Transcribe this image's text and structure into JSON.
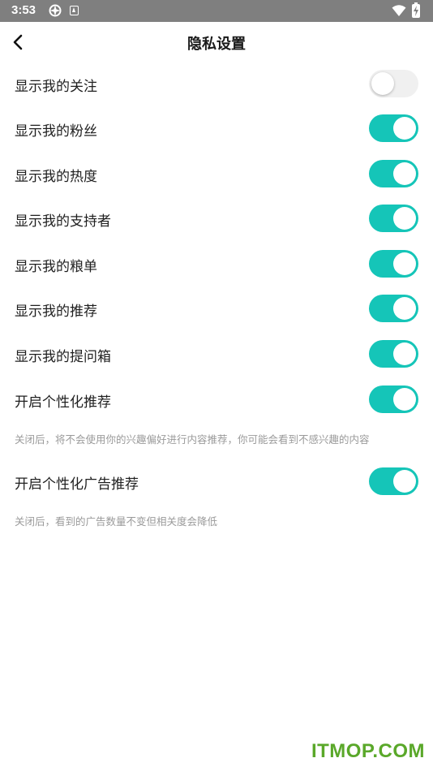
{
  "status_bar": {
    "time": "3:53"
  },
  "header": {
    "title": "隐私设置"
  },
  "settings": [
    {
      "label": "显示我的关注",
      "enabled": false
    },
    {
      "label": "显示我的粉丝",
      "enabled": true
    },
    {
      "label": "显示我的热度",
      "enabled": true
    },
    {
      "label": "显示我的支持者",
      "enabled": true
    },
    {
      "label": "显示我的粮单",
      "enabled": true
    },
    {
      "label": "显示我的推荐",
      "enabled": true
    },
    {
      "label": "显示我的提问箱",
      "enabled": true
    },
    {
      "label": "开启个性化推荐",
      "enabled": true,
      "hint": "关闭后，将不会使用你的兴趣偏好进行内容推荐，你可能会看到不感兴趣的内容"
    },
    {
      "label": "开启个性化广告推荐",
      "enabled": true,
      "hint": "关闭后，看到的广告数量不变但相关度会降低"
    }
  ],
  "colors": {
    "accent": "#15c5b8",
    "status_bar": "#7f7f7f",
    "toggle_off": "#f0f0f0",
    "hint_text": "#9a9a9a"
  },
  "watermark": "ITMOP.COM"
}
